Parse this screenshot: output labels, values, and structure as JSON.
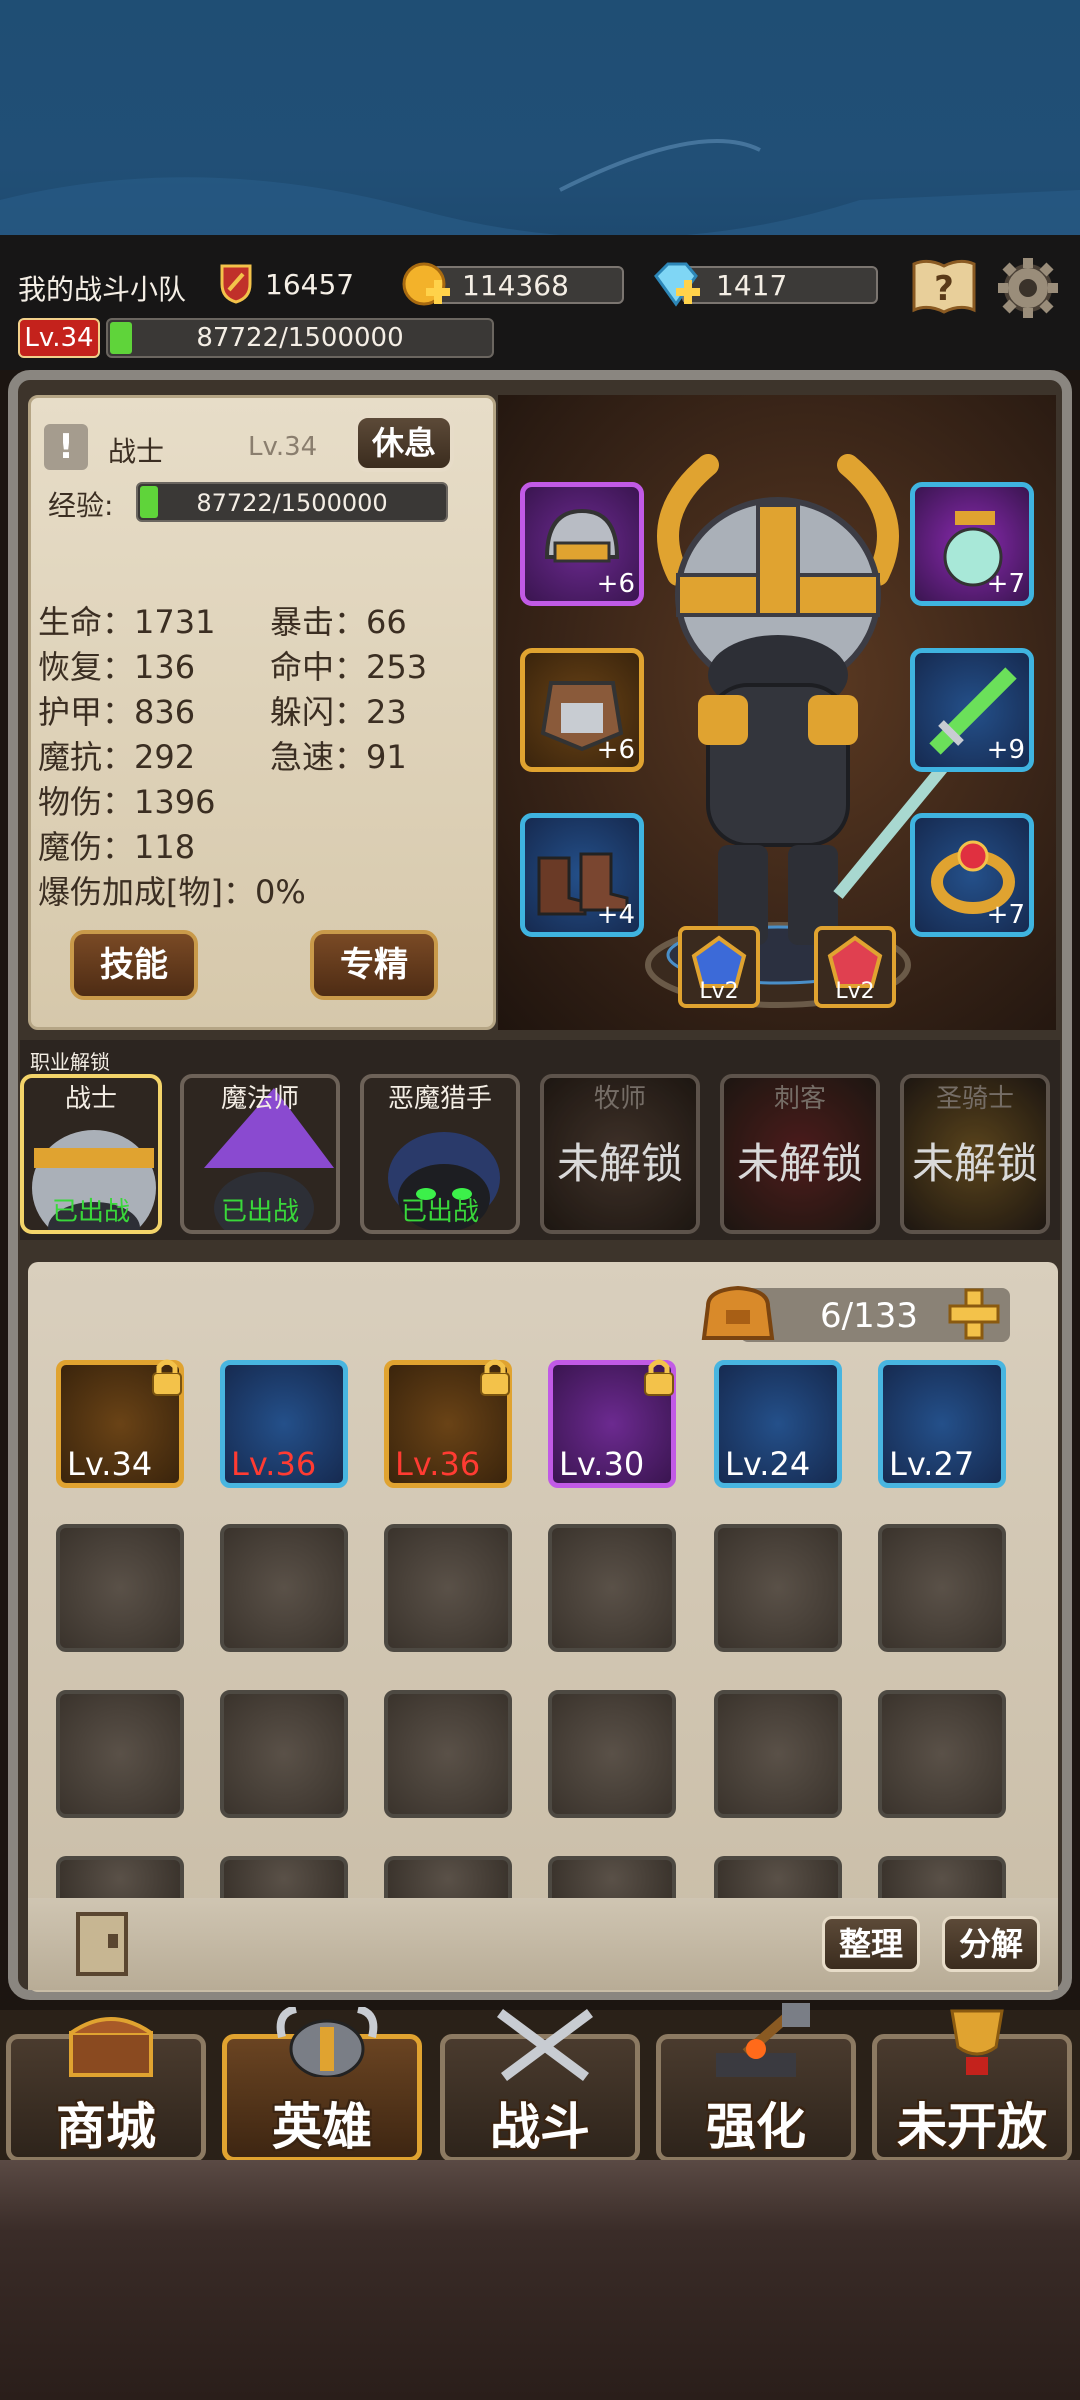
{
  "header": {
    "team_name": "我的战斗小队",
    "power": "16457",
    "gold": "114368",
    "gems": "1417",
    "level_badge": "Lv.34",
    "exp_text": "87722/1500000",
    "exp_fraction": 0.058
  },
  "hero_panel": {
    "class_name": "战士",
    "level": "Lv.34",
    "rest_button": "休息",
    "exp_label": "经验:",
    "exp_text": "87722/1500000",
    "stats_left": [
      "生命：1731",
      "恢复：136",
      "护甲：836",
      "魔抗：292",
      "物伤：1396",
      "魔伤：118",
      "爆伤加成[物]：0%"
    ],
    "stats_right": [
      "暴击：66",
      "命中：253",
      "躲闪：23",
      "急速：91"
    ],
    "skill_button": "技能",
    "spec_button": "专精"
  },
  "equipment": {
    "helmet_plus": "+6",
    "armor_plus": "+6",
    "boots_plus": "+4",
    "amulet_plus": "+7",
    "weapon_plus": "+9",
    "ring_plus": "+7",
    "gem1_level": "Lv2",
    "gem2_level": "Lv2"
  },
  "classes": {
    "section_title": "职业解锁",
    "items": [
      {
        "name": "战士",
        "status": "已出战"
      },
      {
        "name": "魔法师",
        "status": "已出战"
      },
      {
        "name": "恶魔猎手",
        "status": "已出战"
      },
      {
        "name": "牧师",
        "status": "未解锁"
      },
      {
        "name": "刺客",
        "status": "未解锁"
      },
      {
        "name": "圣骑士",
        "status": "未解锁"
      }
    ]
  },
  "inventory": {
    "capacity": "6/133",
    "items": [
      {
        "level": "Lv.34",
        "frame": "orange",
        "locked": true,
        "red": false
      },
      {
        "level": "Lv.36",
        "frame": "blue",
        "locked": false,
        "red": true
      },
      {
        "level": "Lv.36",
        "frame": "orange",
        "locked": true,
        "red": true
      },
      {
        "level": "Lv.30",
        "frame": "purple",
        "locked": true,
        "red": false
      },
      {
        "level": "Lv.24",
        "frame": "blue",
        "locked": false,
        "red": false
      },
      {
        "level": "Lv.27",
        "frame": "blue",
        "locked": false,
        "red": false
      }
    ],
    "sort_button": "整理",
    "decompose_button": "分解"
  },
  "nav": {
    "tabs": [
      "商城",
      "英雄",
      "战斗",
      "强化",
      "未开放"
    ],
    "active": "英雄"
  },
  "colors": {
    "exp_green": "#5fd43a",
    "gold_border": "#e0a330",
    "blue_border": "#48b5e0",
    "purple_border": "#c15ae6",
    "status_green": "#39d83a",
    "level_red": "#ff3b32"
  }
}
